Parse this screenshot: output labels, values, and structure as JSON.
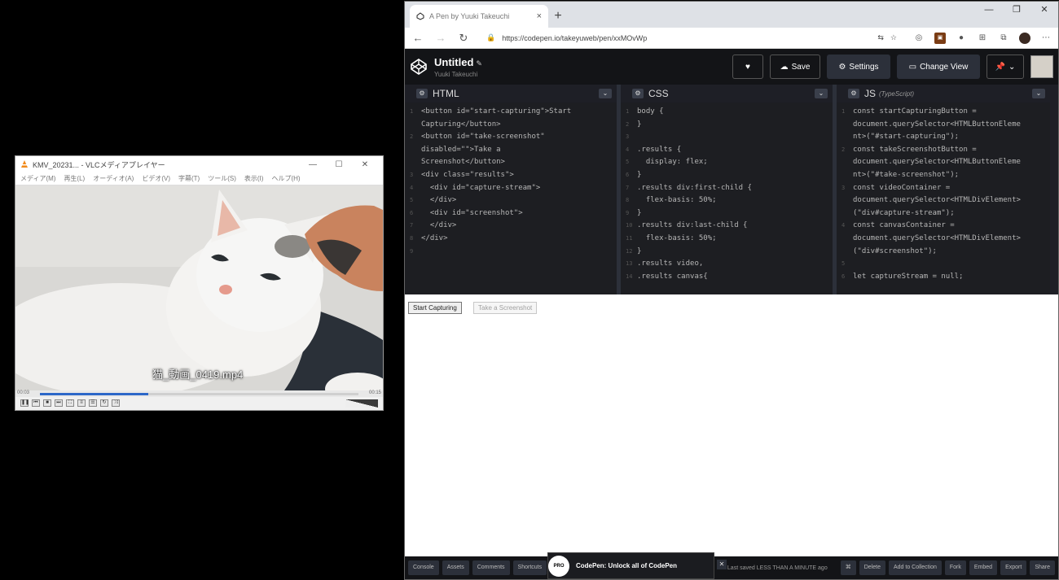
{
  "vlc": {
    "title": "KMV_20231... - VLCメディアプレイヤー",
    "menu": [
      "メディア(M)",
      "再生(L)",
      "オーディオ(A)",
      "ビデオ(V)",
      "字幕(T)",
      "ツール(S)",
      "表示(I)",
      "ヘルプ(H)"
    ],
    "filename_overlay": "猫_動画_0419.mp4",
    "time_elapsed": "00:03",
    "time_total": "00:15",
    "progress": 0.34,
    "volume": 0.8
  },
  "browser": {
    "tab_title": "A Pen by Yuuki Takeuchi",
    "url": "https://codepen.io/takeyuweb/pen/xxMOvWp",
    "new_tab": "+",
    "tab_close": "×"
  },
  "codepen": {
    "title": "Untitled",
    "subtitle": "Yuuki Takeuchi",
    "buttons": {
      "heart": "♥",
      "save": "Save",
      "settings": "Settings",
      "change_view": "Change View",
      "pin": "📌"
    },
    "editors": {
      "html": {
        "name": "HTML",
        "lines": [
          "<button id=\"start-capturing\">Start",
          "Capturing</button>",
          "<button id=\"take-screenshot\"",
          "disabled=\"\">Take a",
          "Screenshot</button>",
          "<div class=\"results\">",
          "  <div id=\"capture-stream\">",
          "  </div>",
          "  <div id=\"screenshot\">",
          "  </div>",
          "</div>",
          ""
        ],
        "line_numbers": [
          "1",
          "",
          "2",
          "",
          "",
          "3",
          "4",
          "5",
          "6",
          "7",
          "8",
          "9"
        ]
      },
      "css": {
        "name": "CSS",
        "lines": [
          "body {",
          "}",
          "",
          ".results {",
          "  display: flex;",
          "}",
          ".results div:first-child {",
          "  flex-basis: 50%;",
          "}",
          ".results div:last-child {",
          "  flex-basis: 50%;",
          "}",
          ".results video,",
          ".results canvas{"
        ],
        "line_numbers": [
          "1",
          "2",
          "3",
          "4",
          "5",
          "6",
          "7",
          "8",
          "9",
          "10",
          "11",
          "12",
          "13",
          "14"
        ]
      },
      "js": {
        "name": "JS",
        "sub": "(TypeScript)",
        "lines": [
          "const startCapturingButton =",
          "document.querySelector<HTMLButtonEleme",
          "nt>(\"#start-capturing\");",
          "const takeScreenshotButton =",
          "document.querySelector<HTMLButtonEleme",
          "nt>(\"#take-screenshot\");",
          "const videoContainer =",
          "document.querySelector<HTMLDivElement>",
          "(\"div#capture-stream\");",
          "const canvasContainer =",
          "document.querySelector<HTMLDivElement>",
          "(\"div#screenshot\");",
          "",
          "let captureStream = null;"
        ],
        "line_numbers": [
          "1",
          "",
          "",
          "2",
          "",
          "",
          "3",
          "",
          "",
          "4",
          "",
          "",
          "5",
          "6"
        ]
      }
    },
    "result": {
      "start_button": "Start Capturing",
      "screenshot_button": "Take a Screenshot"
    },
    "footer": {
      "console": "Console",
      "assets": "Assets",
      "comments": "Comments",
      "shortcuts": "Shortcuts",
      "promo": "CodePen: Unlock all of CodePen",
      "promo_badge": "PRO",
      "saved": "Last saved LESS THAN A MINUTE ago",
      "ext_label": "⌘",
      "delete": "Delete",
      "add_to_collection": "Add to Collection",
      "fork": "Fork",
      "embed": "Embed",
      "export": "Export",
      "share": "Share"
    }
  }
}
